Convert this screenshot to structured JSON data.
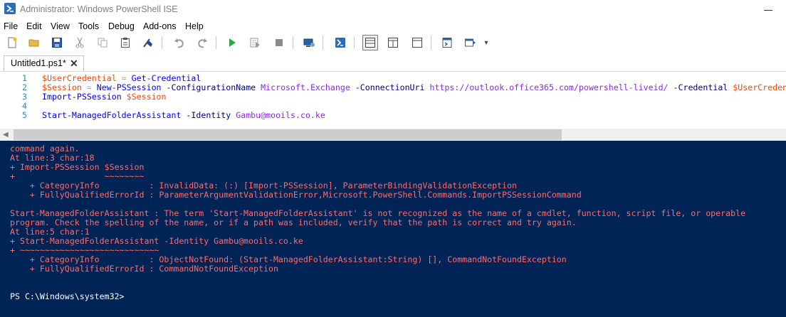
{
  "window": {
    "title": "Administrator: Windows PowerShell ISE"
  },
  "menu": [
    "File",
    "Edit",
    "View",
    "Tools",
    "Debug",
    "Add-ons",
    "Help"
  ],
  "toolbar": {
    "buttons": [
      "new-script",
      "open",
      "save",
      "cut",
      "copy",
      "paste",
      "clear-console",
      "undo",
      "redo",
      "run-script",
      "run-selection",
      "stop",
      "new-remote-tab",
      "start-powershell",
      "show-script-pane-top",
      "show-script-pane-right",
      "show-script-pane-maximized",
      "show-command-window",
      "show-command-addon"
    ],
    "overflow": "▾"
  },
  "tab": {
    "label": "Untitled1.ps1*",
    "close": "✕"
  },
  "editor": {
    "lines": [
      {
        "num": "1",
        "tokens": [
          {
            "t": "$UserCredential",
            "c": "var"
          },
          {
            "t": " = ",
            "c": "op"
          },
          {
            "t": "Get-Credential",
            "c": "cmd"
          }
        ]
      },
      {
        "num": "2",
        "tokens": [
          {
            "t": "$Session",
            "c": "var"
          },
          {
            "t": " = ",
            "c": "op"
          },
          {
            "t": "New-PSSession",
            "c": "cmd"
          },
          {
            "t": " -ConfigurationName ",
            "c": "param"
          },
          {
            "t": "Microsoft.Exchange",
            "c": "arg"
          },
          {
            "t": " -ConnectionUri ",
            "c": "param"
          },
          {
            "t": "https://outlook.office365.com/powershell-liveid/",
            "c": "arg"
          },
          {
            "t": " -Credential ",
            "c": "param"
          },
          {
            "t": "$UserCredential",
            "c": "var"
          }
        ]
      },
      {
        "num": "3",
        "tokens": [
          {
            "t": "Import-PSSession",
            "c": "cmd"
          },
          {
            "t": " ",
            "c": "op"
          },
          {
            "t": "$Session",
            "c": "var"
          }
        ]
      },
      {
        "num": "4",
        "tokens": []
      },
      {
        "num": "5",
        "tokens": [
          {
            "t": "Start-ManagedFolderAssistant",
            "c": "cmd"
          },
          {
            "t": " -Identity ",
            "c": "param"
          },
          {
            "t": "Gambu@mooils.co.ke",
            "c": "arg"
          }
        ]
      }
    ],
    "scroll_left_arrow": "◀"
  },
  "console": {
    "lines": [
      {
        "text": "command again.",
        "c": "err"
      },
      {
        "text": "At line:3 char:18",
        "c": "err"
      },
      {
        "text": "+ Import-PSSession $Session",
        "c": "err"
      },
      {
        "text": "+                  ~~~~~~~~",
        "c": "err"
      },
      {
        "text": "    + CategoryInfo          : InvalidData: (:) [Import-PSSession], ParameterBindingValidationException",
        "c": "err"
      },
      {
        "text": "    + FullyQualifiedErrorId : ParameterArgumentValidationError,Microsoft.PowerShell.Commands.ImportPSSessionCommand",
        "c": "err"
      },
      {
        "text": "",
        "c": "err"
      },
      {
        "text": "Start-ManagedFolderAssistant : The term 'Start-ManagedFolderAssistant' is not recognized as the name of a cmdlet, function, script file, or operable",
        "c": "err"
      },
      {
        "text": "program. Check the spelling of the name, or if a path was included, verify that the path is correct and try again.",
        "c": "err"
      },
      {
        "text": "At line:5 char:1",
        "c": "err"
      },
      {
        "text": "+ Start-ManagedFolderAssistant -Identity Gambu@mooils.co.ke",
        "c": "err"
      },
      {
        "text": "+ ~~~~~~~~~~~~~~~~~~~~~~~~~~~~",
        "c": "err"
      },
      {
        "text": "    + CategoryInfo          : ObjectNotFound: (Start-ManagedFolderAssistant:String) [], CommandNotFoundException",
        "c": "err"
      },
      {
        "text": "    + FullyQualifiedErrorId : CommandNotFoundException",
        "c": "err"
      },
      {
        "text": "",
        "c": "err"
      },
      {
        "text": "",
        "c": "err"
      },
      {
        "text": "PS C:\\Windows\\system32>",
        "c": "prompt"
      }
    ]
  },
  "colors": {
    "console_bg": "#012456",
    "error_text": "#ff6b6b",
    "prompt_text": "#ffffff",
    "variable": "#ff4500",
    "cmdlet": "#0000ff",
    "parameter": "#000080",
    "argument": "#8a2be2",
    "line_number": "#2b91af"
  }
}
